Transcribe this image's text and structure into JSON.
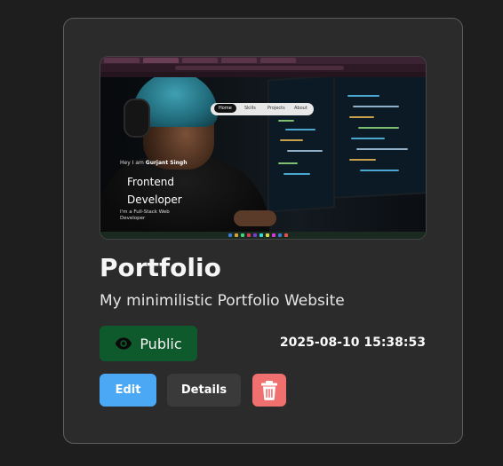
{
  "card": {
    "title": "Portfolio",
    "description": "My minimilistic Portfolio Website",
    "visibility_label": "Public",
    "timestamp": "2025-08-10 15:38:53",
    "edit_label": "Edit",
    "details_label": "Details",
    "delete_icon": "trash-icon",
    "visibility_icon": "eye-icon"
  },
  "preview": {
    "nav": [
      "Home",
      "Skills",
      "Projects",
      "About"
    ],
    "greeting_prefix": "Hey I am",
    "greeting_name": "Gurjant Singh",
    "headline_line1": "Frontend",
    "headline_line2": "Developer",
    "tagline": "I'm a Full-Stack Web Developer"
  },
  "colors": {
    "visibility_bg": "#0f5a2c",
    "edit_bg": "#4aa8f5",
    "details_bg": "#3a3a3a",
    "delete_bg": "#f07070"
  }
}
